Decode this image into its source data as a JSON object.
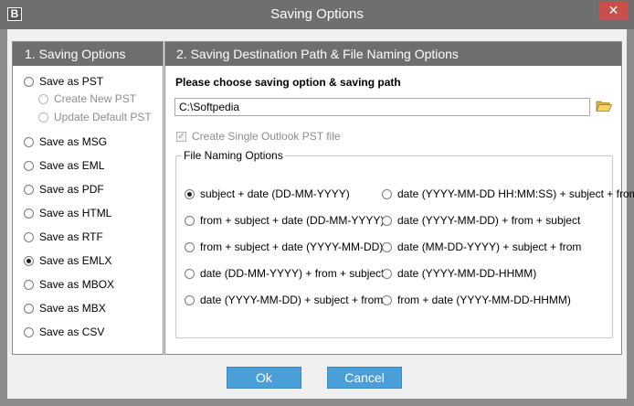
{
  "window": {
    "title": "Saving Options",
    "icon_letter": "B",
    "close_glyph": "✕"
  },
  "left_pane": {
    "header": "1. Saving Options",
    "options": [
      {
        "label": "Save as PST",
        "checked": false,
        "disabled": false
      },
      {
        "label": "Create New PST",
        "checked": false,
        "disabled": true
      },
      {
        "label": "Update Default PST",
        "checked": false,
        "disabled": true
      },
      {
        "label": "Save as MSG",
        "checked": false,
        "disabled": false
      },
      {
        "label": "Save as EML",
        "checked": false,
        "disabled": false
      },
      {
        "label": "Save as PDF",
        "checked": false,
        "disabled": false
      },
      {
        "label": "Save as HTML",
        "checked": false,
        "disabled": false
      },
      {
        "label": "Save as RTF",
        "checked": false,
        "disabled": false
      },
      {
        "label": "Save as EMLX",
        "checked": true,
        "disabled": false
      },
      {
        "label": "Save as MBOX",
        "checked": false,
        "disabled": false
      },
      {
        "label": "Save as MBX",
        "checked": false,
        "disabled": false
      },
      {
        "label": "Save as CSV",
        "checked": false,
        "disabled": false
      }
    ]
  },
  "right_pane": {
    "header": "2. Saving Destination Path & File Naming Options",
    "prompt": "Please choose saving option & saving path",
    "path_value": "C:\\Softpedia",
    "single_pst": {
      "label": "Create Single Outlook PST file",
      "checked": true,
      "disabled": true
    },
    "naming_group": {
      "legend": "File Naming Options",
      "options": [
        {
          "label": "subject + date (DD-MM-YYYY)",
          "checked": true
        },
        {
          "label": "from + subject + date (DD-MM-YYYY)",
          "checked": false
        },
        {
          "label": "from + subject + date (YYYY-MM-DD)",
          "checked": false
        },
        {
          "label": "date (DD-MM-YYYY) + from + subject",
          "checked": false
        },
        {
          "label": "date (YYYY-MM-DD) + subject + from",
          "checked": false
        },
        {
          "label": "date (YYYY-MM-DD HH:MM:SS) + subject + from",
          "checked": false
        },
        {
          "label": "date (YYYY-MM-DD) + from + subject",
          "checked": false
        },
        {
          "label": "date (MM-DD-YYYY) + subject + from",
          "checked": false
        },
        {
          "label": "date (YYYY-MM-DD-HHMM)",
          "checked": false
        },
        {
          "label": "from + date (YYYY-MM-DD-HHMM)",
          "checked": false
        }
      ]
    }
  },
  "buttons": {
    "ok": "Ok",
    "cancel": "Cancel"
  },
  "colors": {
    "titlebar": "#6f6f6f",
    "pane_header": "#6e6e6e",
    "button": "#4a9fd8",
    "close": "#c7504c"
  }
}
